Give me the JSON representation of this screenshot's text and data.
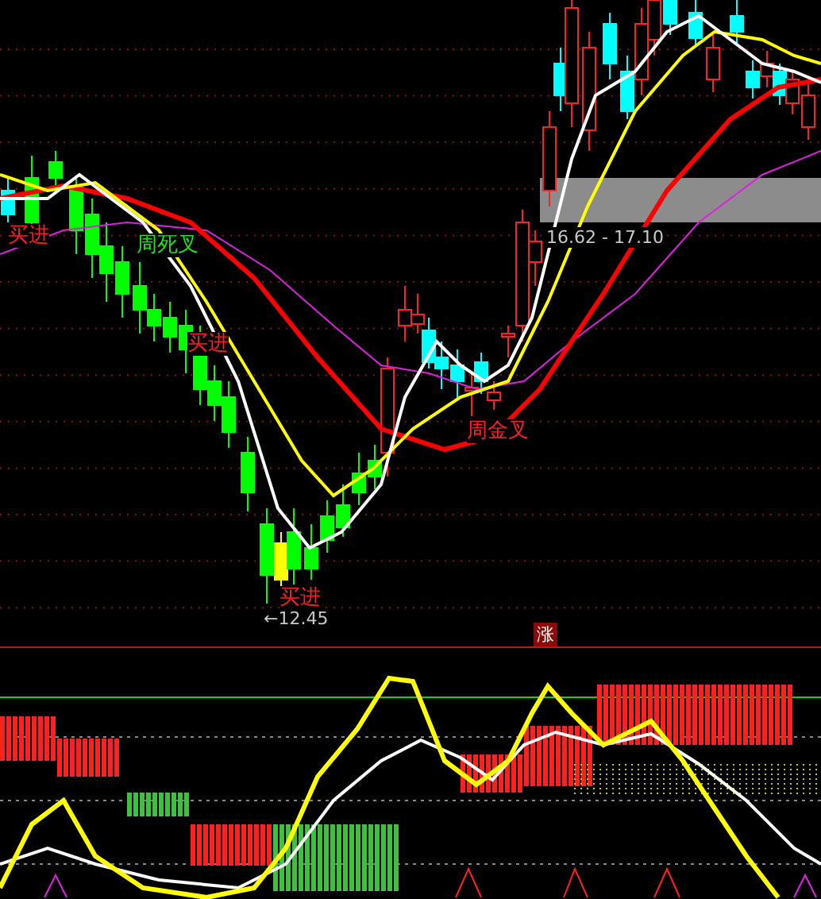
{
  "price_chart": {
    "signals": [
      {
        "text": "买进",
        "color": "#ff2020"
      },
      {
        "text": "周死叉",
        "color": "#20e020"
      },
      {
        "text": "买进",
        "color": "#ff2020"
      },
      {
        "text": "周金叉",
        "color": "#ff2020"
      },
      {
        "text": "买进",
        "color": "#ff2020"
      }
    ],
    "price_range": "16.62 - 17.10",
    "low_marker": "←12.45"
  },
  "divider_badge": "涨"
}
